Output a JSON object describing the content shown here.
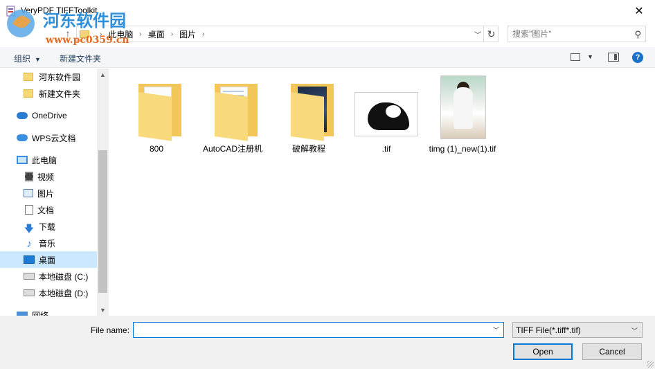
{
  "window": {
    "title": "VeryPDF TIFFToolkit",
    "close_glyph": "✕"
  },
  "watermark": {
    "text_cn": "河东软件园",
    "text_url": "www.pc0359.cn"
  },
  "address": {
    "breadcrumbs": [
      "此电脑",
      "桌面",
      "图片"
    ],
    "search_placeholder": "搜索\"图片\""
  },
  "toolbar": {
    "organize_label": "组织",
    "new_folder_label": "新建文件夹"
  },
  "nav": {
    "items": [
      {
        "label": "河东软件园",
        "icon": "folder-icon"
      },
      {
        "label": "新建文件夹",
        "icon": "folder-icon"
      },
      {
        "label": "OneDrive",
        "icon": "onedrive-icon"
      },
      {
        "label": "WPS云文档",
        "icon": "wps-cloud-icon"
      },
      {
        "label": "此电脑",
        "icon": "computer-icon"
      },
      {
        "label": "视频",
        "icon": "video-icon"
      },
      {
        "label": "图片",
        "icon": "pictures-icon"
      },
      {
        "label": "文档",
        "icon": "documents-icon"
      },
      {
        "label": "下载",
        "icon": "download-icon"
      },
      {
        "label": "音乐",
        "icon": "music-icon"
      },
      {
        "label": "桌面",
        "icon": "desktop-icon",
        "selected": true
      },
      {
        "label": "本地磁盘 (C:)",
        "icon": "drive-icon"
      },
      {
        "label": "本地磁盘 (D:)",
        "icon": "drive-icon"
      },
      {
        "label": "网络",
        "icon": "network-icon"
      }
    ]
  },
  "files": [
    {
      "name": "800",
      "type": "folder"
    },
    {
      "name": "AutoCAD注册机",
      "type": "folder"
    },
    {
      "name": "破解教程",
      "type": "folder"
    },
    {
      "name": ".tif",
      "type": "image"
    },
    {
      "name": "timg (1)_new(1).tif",
      "type": "image"
    }
  ],
  "bottom": {
    "filename_label": "File name:",
    "filename_value": "",
    "filetype_value": "TIFF File(*.tiff*.tif)",
    "open_label": "Open",
    "cancel_label": "Cancel"
  },
  "colors": {
    "accent": "#0078d7",
    "selected_bg": "#cce8ff",
    "toolbar_bg": "#f5f6f7",
    "bottom_bg": "#f0f0f0"
  }
}
